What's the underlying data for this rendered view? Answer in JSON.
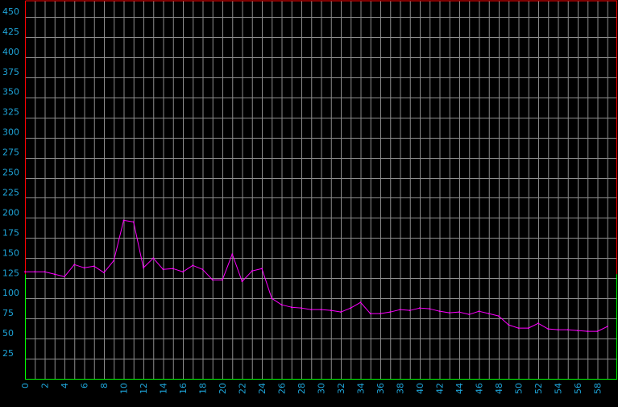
{
  "chart_data": {
    "type": "line",
    "title": "",
    "xlabel": "",
    "ylabel": "",
    "xlim": [
      0,
      60
    ],
    "ylim": [
      0,
      470
    ],
    "x_tick_labels": [
      "0",
      "2",
      "4",
      "6",
      "8",
      "10",
      "12",
      "14",
      "16",
      "18",
      "20",
      "22",
      "24",
      "26",
      "28",
      "30",
      "32",
      "34",
      "36",
      "38",
      "40",
      "42",
      "44",
      "46",
      "48",
      "50",
      "52",
      "54",
      "56",
      "58"
    ],
    "y_tick_labels": [
      "25",
      "50",
      "75",
      "100",
      "125",
      "150",
      "175",
      "200",
      "225",
      "250",
      "275",
      "300",
      "325",
      "350",
      "375",
      "400",
      "425",
      "450"
    ],
    "grid": true,
    "colors": {
      "background": "#000000",
      "grid": "#8c8c8c",
      "line": "#ff00ff",
      "tick_labels": "#1ea4d8",
      "frame_upper": "#ff0000",
      "frame_lower": "#00ff00",
      "lower_threshold": 130
    },
    "series": [
      {
        "values": [
          133,
          133,
          133,
          130,
          127,
          142,
          138,
          140,
          132,
          147,
          197,
          195,
          138,
          150,
          136,
          137,
          133,
          141,
          136,
          123,
          123,
          155,
          121,
          134,
          137,
          100,
          92,
          89,
          88,
          86,
          86,
          85,
          83,
          88,
          95,
          81,
          81,
          83,
          86,
          85,
          88,
          87,
          84,
          82,
          83,
          80,
          84,
          81,
          78,
          67,
          63,
          63,
          69,
          62,
          61,
          61,
          60,
          59,
          59,
          65
        ]
      }
    ]
  }
}
